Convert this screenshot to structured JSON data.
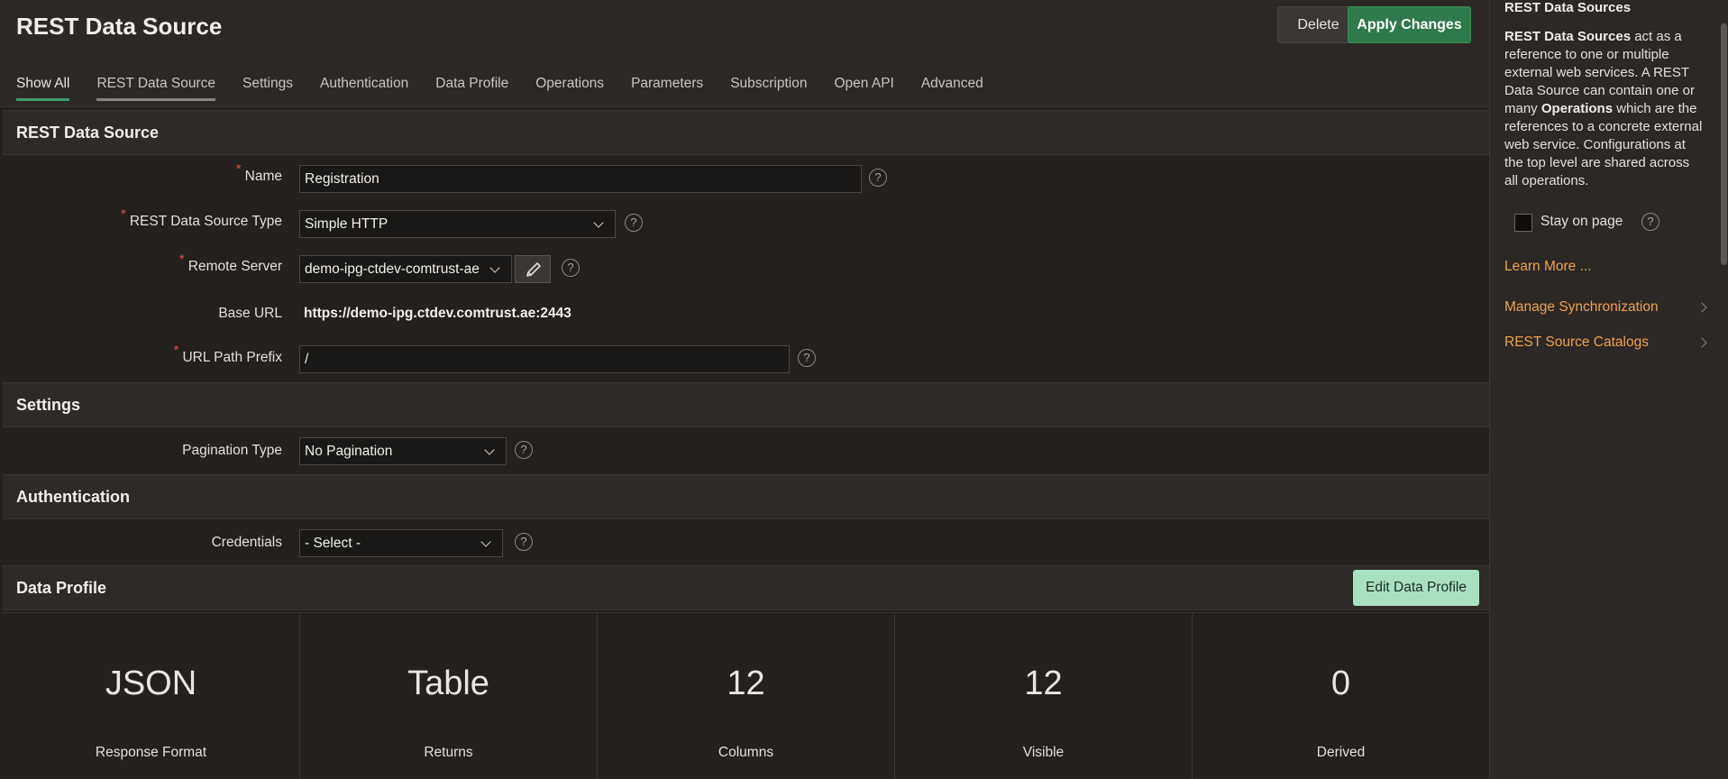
{
  "header": {
    "title": "REST Data Source",
    "delete_label": "Delete",
    "apply_label": "Apply Changes"
  },
  "tabs": [
    "Show All",
    "REST Data Source",
    "Settings",
    "Authentication",
    "Data Profile",
    "Operations",
    "Parameters",
    "Subscription",
    "Open API",
    "Advanced"
  ],
  "sections": {
    "rest": "REST Data Source",
    "settings": "Settings",
    "auth": "Authentication",
    "profile": "Data Profile"
  },
  "form": {
    "name": {
      "label": "Name",
      "value": "Registration"
    },
    "type": {
      "label": "REST Data Source Type",
      "value": "Simple HTTP"
    },
    "server": {
      "label": "Remote Server",
      "value": "demo-ipg-ctdev-comtrust-ae"
    },
    "base_url": {
      "label": "Base URL",
      "value": "https://demo-ipg.ctdev.comtrust.ae:2443"
    },
    "prefix": {
      "label": "URL Path Prefix",
      "value": "/"
    },
    "pagination": {
      "label": "Pagination Type",
      "value": "No Pagination"
    },
    "credentials": {
      "label": "Credentials",
      "value": "- Select -"
    }
  },
  "profile": {
    "edit_label": "Edit Data Profile",
    "stats": [
      {
        "value": "JSON",
        "label": "Response Format"
      },
      {
        "value": "Table",
        "label": "Returns"
      },
      {
        "value": "12",
        "label": "Columns"
      },
      {
        "value": "12",
        "label": "Visible"
      },
      {
        "value": "0",
        "label": "Derived"
      }
    ]
  },
  "side": {
    "title": "REST Data Sources",
    "desc_a": "REST Data Sources",
    "desc_b": " act as a reference to one or multiple external web services. A REST Data Source can contain one or many ",
    "desc_c": "Operations",
    "desc_d": " which are the references to a concrete external web service. Configurations at the top level are shared across all operations.",
    "stay_label": "Stay on page",
    "learn_more": "Learn More ...",
    "link1": "Manage Synchronization",
    "link2": "REST Source Catalogs"
  },
  "colors": {
    "accent_green": "#2f7a4a",
    "link_orange": "#f0a24a",
    "required_red": "#d9534f"
  },
  "icons": [
    "help-icon",
    "pencil-icon",
    "chevron-down-icon",
    "chevron-right-icon"
  ]
}
